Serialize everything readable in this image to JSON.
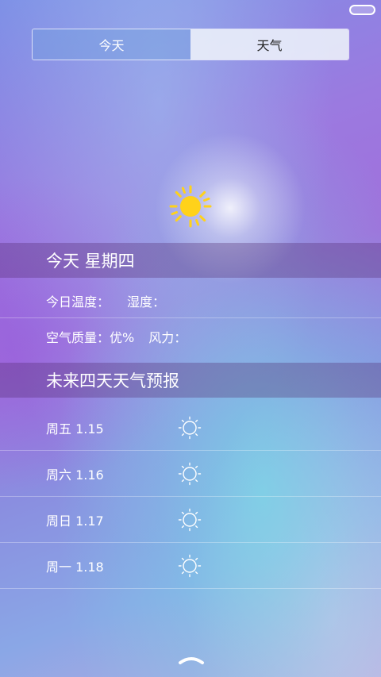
{
  "tabs": [
    {
      "label": "今天",
      "active": true
    },
    {
      "label": "天气",
      "active": false
    }
  ],
  "current": {
    "icon": "sun-icon",
    "header": "今天 星期四",
    "temp_label": "今日温度：",
    "humidity_label": "湿度：",
    "air_label": "空气质量：优%",
    "wind_label": "风力："
  },
  "forecast": {
    "header": "未来四天天气预报",
    "days": [
      {
        "day": "周五 1.15",
        "icon": "sun-outline-icon"
      },
      {
        "day": "周六 1.16",
        "icon": "sun-outline-icon"
      },
      {
        "day": "周日 1.17",
        "icon": "sun-outline-icon"
      },
      {
        "day": "周一 1.18",
        "icon": "sun-outline-icon"
      }
    ]
  },
  "colors": {
    "sun": "#ffd21a",
    "band": "#50286e"
  }
}
